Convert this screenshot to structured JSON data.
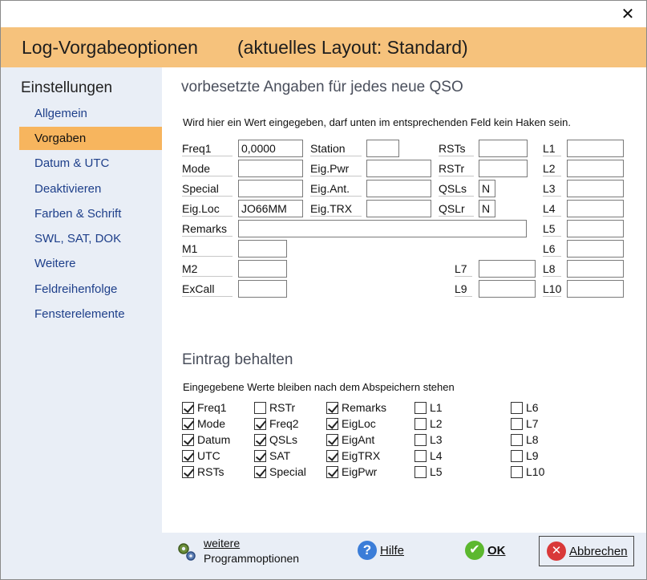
{
  "window": {
    "title": "Log-Vorgabeoptionen",
    "subtitle": "(aktuelles Layout: Standard)",
    "close_icon": "close-icon"
  },
  "sidebar": {
    "heading": "Einstellungen",
    "items": [
      {
        "label": "Allgemein"
      },
      {
        "label": "Vorgaben"
      },
      {
        "label": "Datum & UTC"
      },
      {
        "label": "Deaktivieren"
      },
      {
        "label": "Farben & Schrift"
      },
      {
        "label": "SWL, SAT, DOK"
      },
      {
        "label": "Weitere"
      },
      {
        "label": "Feldreihenfolge"
      },
      {
        "label": "Fensterelemente"
      }
    ],
    "active_index": 1
  },
  "defaults": {
    "title": "vorbesetzte Angaben für jedes neue QSO",
    "note": "Wird hier ein Wert eingegeben, darf unten im entsprechenden Feld kein Haken sein.",
    "fields": {
      "freq1": {
        "label": "Freq1",
        "value": "0,0000"
      },
      "mode": {
        "label": "Mode",
        "value": ""
      },
      "special": {
        "label": "Special",
        "value": ""
      },
      "eigloc": {
        "label": "Eig.Loc",
        "value": "JO66MM"
      },
      "remarks": {
        "label": "Remarks",
        "value": ""
      },
      "m1": {
        "label": "M1",
        "value": ""
      },
      "m2": {
        "label": "M2",
        "value": ""
      },
      "excall": {
        "label": "ExCall",
        "value": ""
      },
      "station": {
        "label": "Station",
        "value": ""
      },
      "eigpwr": {
        "label": "Eig.Pwr",
        "value": ""
      },
      "eigant": {
        "label": "Eig.Ant.",
        "value": ""
      },
      "eigtrx": {
        "label": "Eig.TRX",
        "value": ""
      },
      "rsts": {
        "label": "RSTs",
        "value": ""
      },
      "rstr": {
        "label": "RSTr",
        "value": ""
      },
      "qsls": {
        "label": "QSLs",
        "value": "N"
      },
      "qslr": {
        "label": "QSLr",
        "value": "N"
      },
      "l7": {
        "label": "L7",
        "value": ""
      },
      "l9": {
        "label": "L9",
        "value": ""
      },
      "l1": {
        "label": "L1",
        "value": ""
      },
      "l2": {
        "label": "L2",
        "value": ""
      },
      "l3": {
        "label": "L3",
        "value": ""
      },
      "l4": {
        "label": "L4",
        "value": ""
      },
      "l5": {
        "label": "L5",
        "value": ""
      },
      "l6": {
        "label": "L6",
        "value": ""
      },
      "l8": {
        "label": "L8",
        "value": ""
      },
      "l10": {
        "label": "L10",
        "value": ""
      }
    }
  },
  "keep": {
    "title": "Eintrag behalten",
    "note": "Eingegebene Werte bleiben nach dem Abspeichern stehen",
    "columns": [
      [
        {
          "label": "Freq1",
          "checked": true
        },
        {
          "label": "Mode",
          "checked": true
        },
        {
          "label": "Datum",
          "checked": true
        },
        {
          "label": "UTC",
          "checked": true
        },
        {
          "label": "RSTs",
          "checked": true
        }
      ],
      [
        {
          "label": "RSTr",
          "checked": false
        },
        {
          "label": "Freq2",
          "checked": true
        },
        {
          "label": "QSLs",
          "checked": true
        },
        {
          "label": "SAT",
          "checked": true
        },
        {
          "label": "Special",
          "checked": true
        }
      ],
      [
        {
          "label": "Remarks",
          "checked": true
        },
        {
          "label": "EigLoc",
          "checked": true
        },
        {
          "label": "EigAnt",
          "checked": true
        },
        {
          "label": "EigTRX",
          "checked": true
        },
        {
          "label": "EigPwr",
          "checked": true
        }
      ],
      [
        {
          "label": "L1",
          "checked": false
        },
        {
          "label": "L2",
          "checked": false
        },
        {
          "label": "L3",
          "checked": false
        },
        {
          "label": "L4",
          "checked": false
        },
        {
          "label": "L5",
          "checked": false
        }
      ],
      [
        {
          "label": "L6",
          "checked": false
        },
        {
          "label": "L7",
          "checked": false
        },
        {
          "label": "L8",
          "checked": false
        },
        {
          "label": "L9",
          "checked": false
        },
        {
          "label": "L10",
          "checked": false
        }
      ]
    ]
  },
  "footer": {
    "more_line1": "weitere",
    "more_line2": "Programmoptionen",
    "help": "Hilfe",
    "ok": "OK",
    "cancel": "Abbrechen",
    "more_icon": "gears-icon",
    "help_icon": "question-icon",
    "ok_icon": "checkmark-icon",
    "cancel_icon": "cross-icon"
  }
}
